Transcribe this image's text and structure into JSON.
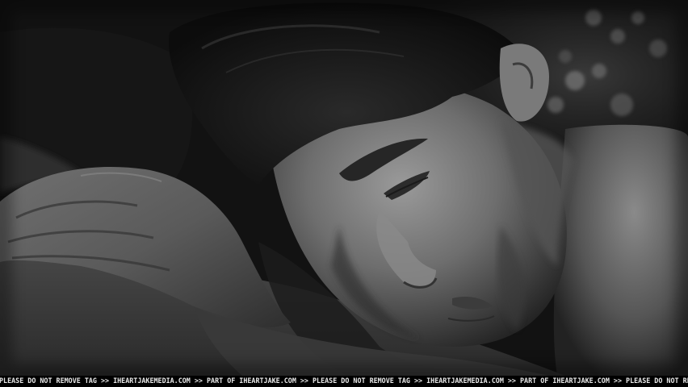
{
  "image": {
    "kind": "black-and-white photograph",
    "watermark_text": "PLEASE DO NOT REMOVE TAG >> IHEARTJAKEMEDIA.COM >> PART OF IHEARTJAKE.COM >> PLEASE DO NOT REMOVE TAG >> IHEARTJAKEMEDIA.COM >> PART OF IHEARTJAKE.COM >> PLEASE DO NOT REMOVE TAG >> IHEARTJAKEM"
  }
}
